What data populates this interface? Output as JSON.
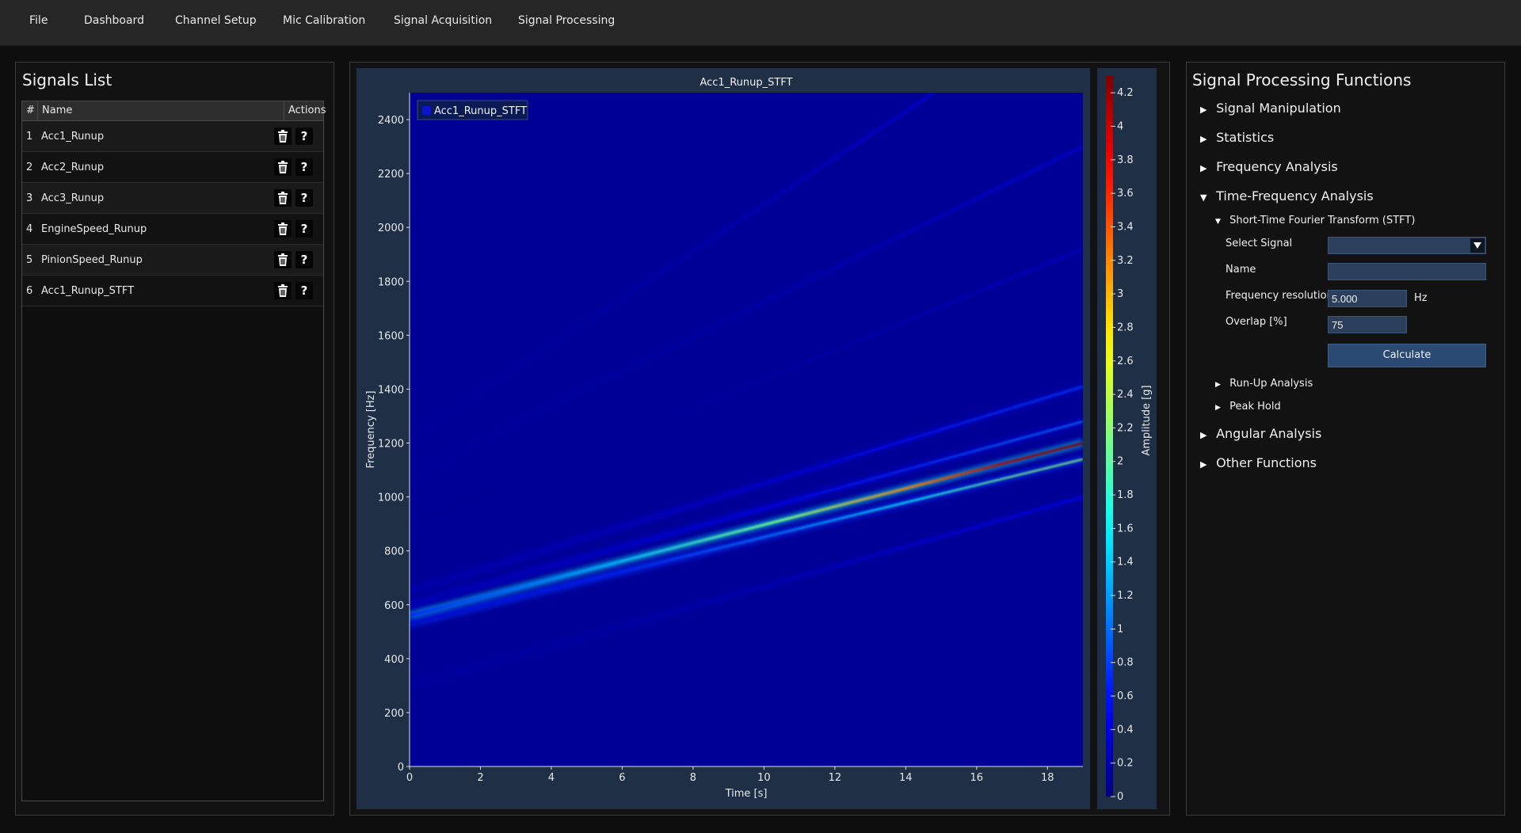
{
  "menu": {
    "items": [
      "File",
      "Dashboard",
      "Channel Setup",
      "Mic Calibration",
      "Signal Acquisition",
      "Signal Processing"
    ]
  },
  "signals_list": {
    "title": "Signals List",
    "columns": [
      "#",
      "Name",
      "Actions"
    ],
    "rows": [
      {
        "num": "1",
        "name": "Acc1_Runup"
      },
      {
        "num": "2",
        "name": "Acc2_Runup"
      },
      {
        "num": "3",
        "name": "Acc3_Runup"
      },
      {
        "num": "4",
        "name": "EngineSpeed_Runup"
      },
      {
        "num": "5",
        "name": "PinionSpeed_Runup"
      },
      {
        "num": "6",
        "name": "Acc1_Runup_STFT"
      }
    ],
    "delete_icon": "trash-icon",
    "help_label": "?"
  },
  "chart_data": {
    "type": "heatmap",
    "title": "Acc1_Runup_STFT",
    "legend": [
      "Acc1_Runup_STFT"
    ],
    "legend_position": "top-left",
    "xlabel": "Time [s]",
    "ylabel": "Frequency [Hz]",
    "xlim": [
      0,
      19
    ],
    "ylim": [
      0,
      2500
    ],
    "xticks": [
      0,
      2,
      4,
      6,
      8,
      10,
      12,
      14,
      16,
      18
    ],
    "yticks": [
      0,
      200,
      400,
      600,
      800,
      1000,
      1200,
      1400,
      1600,
      1800,
      2000,
      2200,
      2400
    ],
    "colorbar": {
      "label": "Amplitude [g]",
      "range": [
        0,
        4.3
      ],
      "ticks": [
        0,
        0.2,
        0.4,
        0.6,
        0.8,
        1,
        1.2,
        1.4,
        1.6,
        1.8,
        2,
        2.2,
        2.4,
        2.6,
        2.8,
        3,
        3.2,
        3.4,
        3.6,
        3.8,
        4,
        4.2
      ],
      "colormap": "jet"
    },
    "background_amplitude": 0.1,
    "ridges": [
      {
        "t": [
          0,
          19
        ],
        "f": [
          560,
          1200
        ],
        "peak_amplitude": 4.3
      },
      {
        "t": [
          0,
          19
        ],
        "f": [
          530,
          1140
        ],
        "peak_amplitude": 2.2
      },
      {
        "t": [
          0,
          19
        ],
        "f": [
          600,
          1280
        ],
        "peak_amplitude": 1.0
      },
      {
        "t": [
          0,
          19
        ],
        "f": [
          650,
          1410
        ],
        "peak_amplitude": 0.8
      },
      {
        "t": [
          0,
          19
        ],
        "f": [
          300,
          1000
        ],
        "peak_amplitude": 0.5
      },
      {
        "t": [
          0,
          19
        ],
        "f": [
          1080,
          2300
        ],
        "peak_amplitude": 0.4
      },
      {
        "t": [
          0,
          14.8
        ],
        "f": [
          1220,
          2500
        ],
        "peak_amplitude": 0.4
      },
      {
        "t": [
          0,
          19
        ],
        "f": [
          900,
          1920
        ],
        "peak_amplitude": 0.3
      }
    ]
  },
  "functions": {
    "title": "Signal Processing Functions",
    "sections": {
      "signal_manipulation": "Signal Manipulation",
      "statistics": "Statistics",
      "frequency_analysis": "Frequency Analysis",
      "time_frequency_analysis": "Time-Frequency Analysis",
      "stft": "Short-Time Fourier Transform (STFT)",
      "runup_analysis": "Run-Up Analysis",
      "peak_hold": "Peak Hold",
      "angular_analysis": "Angular Analysis",
      "other_functions": "Other Functions"
    },
    "stft_form": {
      "select_signal_label": "Select Signal",
      "select_signal_value": "",
      "name_label": "Name",
      "name_value": "",
      "freq_res_label": "Frequency resolution",
      "freq_res_value": "5.000",
      "freq_res_unit": "Hz",
      "overlap_label": "Overlap [%]",
      "overlap_value": "75",
      "calculate_label": "Calculate"
    }
  }
}
